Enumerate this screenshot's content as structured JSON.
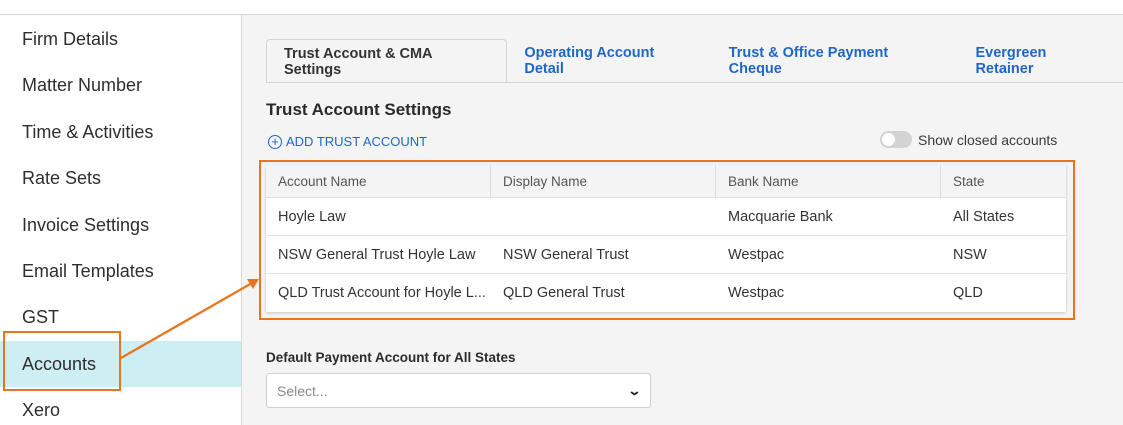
{
  "sidebar": {
    "items": [
      {
        "label": "Firm Details"
      },
      {
        "label": "Matter Number"
      },
      {
        "label": "Time & Activities"
      },
      {
        "label": "Rate Sets"
      },
      {
        "label": "Invoice Settings"
      },
      {
        "label": "Email Templates"
      },
      {
        "label": "GST"
      },
      {
        "label": "Accounts"
      },
      {
        "label": "Xero"
      }
    ],
    "active": "Accounts"
  },
  "tabs": [
    {
      "label": "Trust Account & CMA Settings"
    },
    {
      "label": "Operating Account Detail"
    },
    {
      "label": "Trust & Office Payment Cheque"
    },
    {
      "label": "Evergreen Retainer"
    }
  ],
  "trust_settings": {
    "title": "Trust Account Settings",
    "add_label": "ADD TRUST ACCOUNT",
    "show_closed_label": "Show closed accounts",
    "show_closed_on": false
  },
  "table": {
    "headers": [
      "Account Name",
      "Display Name",
      "Bank Name",
      "State"
    ],
    "rows": [
      [
        "Hoyle Law",
        "",
        "Macquarie Bank",
        "All States"
      ],
      [
        "NSW General Trust Hoyle Law",
        "NSW General Trust",
        "Westpac",
        "NSW"
      ],
      [
        "QLD Trust Account for Hoyle L...",
        "QLD General Trust",
        "Westpac",
        "QLD"
      ]
    ]
  },
  "default_payment": {
    "label": "Default Payment Account for All States",
    "placeholder": "Select..."
  },
  "colors": {
    "accent": "#1f67c7",
    "active_bg": "#cdeef3",
    "annotation": "#e8741e"
  }
}
